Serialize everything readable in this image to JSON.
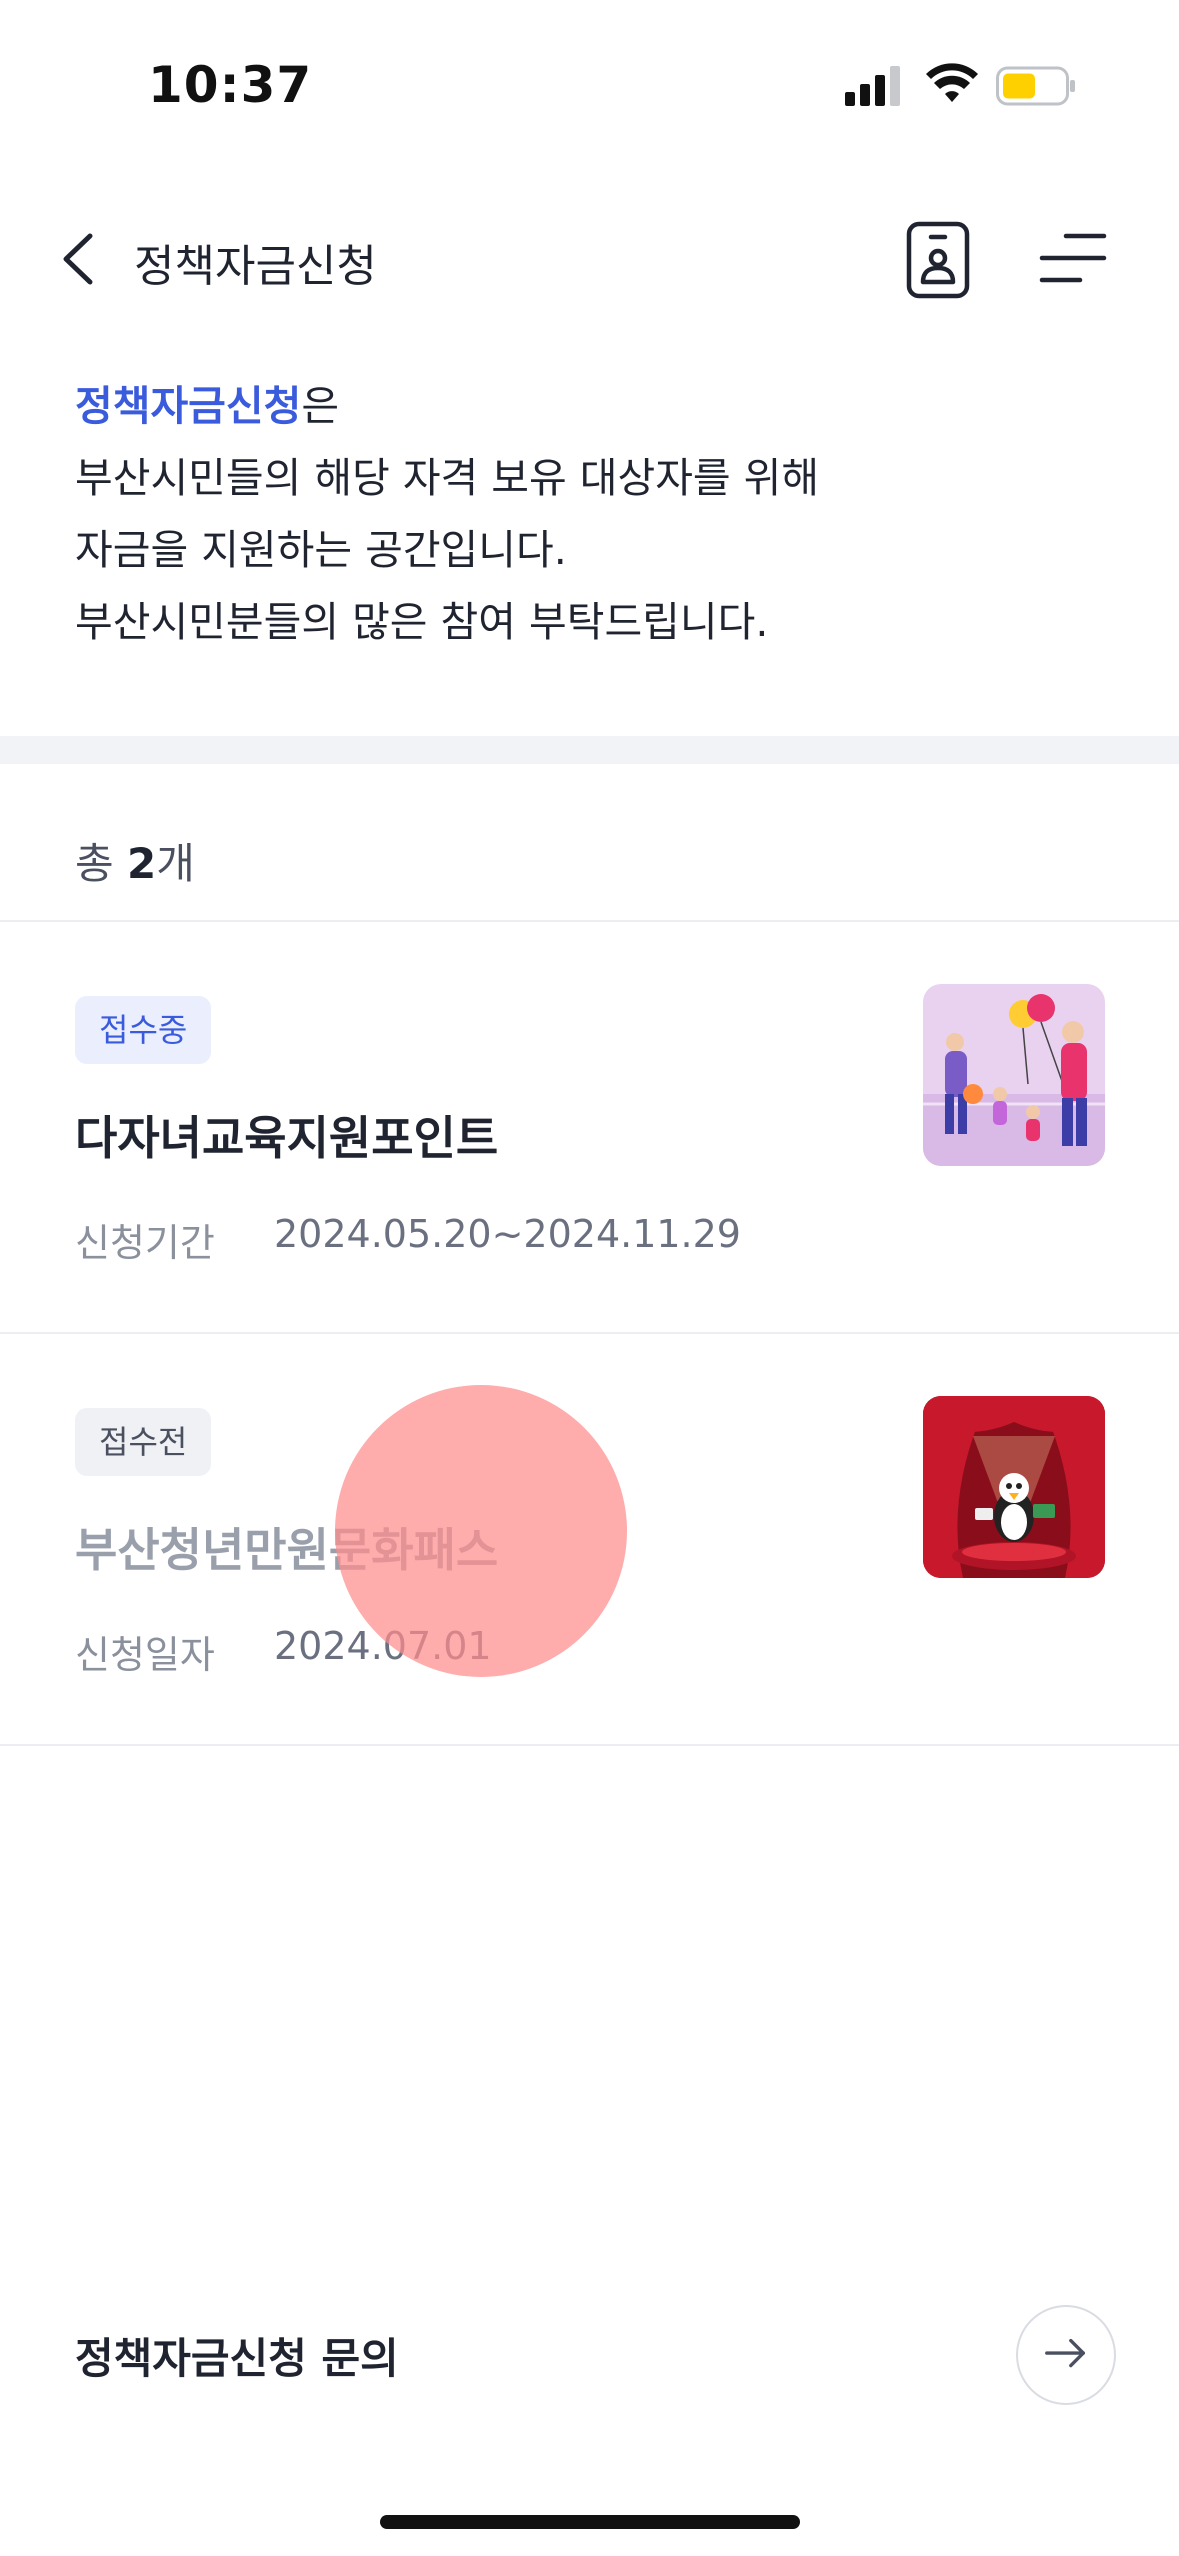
{
  "status_bar": {
    "time": "10:37",
    "battery_color": "#ffd000"
  },
  "header": {
    "title": "정책자금신청",
    "back_icon": "chevron-left-icon",
    "id_icon": "id-badge-icon",
    "menu_icon": "menu-icon"
  },
  "intro": {
    "highlight": "정책자금신청",
    "highlight_suffix": "은",
    "lines": [
      "부산시민들의 해당 자격 보유 대상자를 위해",
      "자금을 지원하는 공간입니다.",
      "부산시민분들의 많은 참여 부탁드립니다."
    ]
  },
  "summary": {
    "prefix": "총 ",
    "count": "2",
    "suffix": "개"
  },
  "items": [
    {
      "badge": "접수중",
      "title": "다자녀교육지원포인트",
      "meta_label": "신청기간",
      "meta_value": "2024.05.20~2024.11.29",
      "thumbnail": "family-with-balloons-image"
    },
    {
      "badge": "접수전",
      "title": "부산청년만원문화패스",
      "meta_label": "신청일자",
      "meta_value": "2024.07.01",
      "thumbnail": "stage-mascot-image"
    }
  ],
  "footer": {
    "inquiry_label": "정책자금신청 문의",
    "arrow_icon": "arrow-right-icon"
  },
  "colors": {
    "accent": "#3a5bdc",
    "badge_open_bg": "#eaeefd",
    "badge_closed_bg": "#f0f1f4"
  }
}
